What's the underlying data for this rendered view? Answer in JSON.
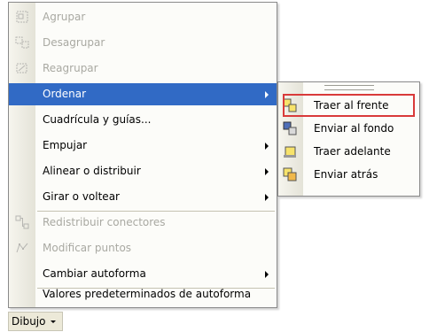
{
  "menu": {
    "agrupar": "Agrupar",
    "desagrupar": "Desagrupar",
    "reagrupar": "Reagrupar",
    "ordenar": "Ordenar",
    "cuadricula": "Cuadrícula y guías...",
    "empujar": "Empujar",
    "alinear": "Alinear o distribuir",
    "girar": "Girar o voltear",
    "redistribuir": "Redistribuir conectores",
    "modificar": "Modificar puntos",
    "cambiar": "Cambiar autoforma",
    "valores": "Valores predeterminados de autoforma"
  },
  "submenu": {
    "traer_frente": "Traer al frente",
    "enviar_fondo": "Enviar al fondo",
    "traer_adelante": "Traer adelante",
    "enviar_atras": "Enviar atrás"
  },
  "toolbar": {
    "dibujo": "Dibujo"
  },
  "colors": {
    "highlight": "#316ac5",
    "annotation_border": "#d93a3a",
    "shape_yellow": "#f7e36b",
    "shape_blue": "#4f6fb8"
  }
}
